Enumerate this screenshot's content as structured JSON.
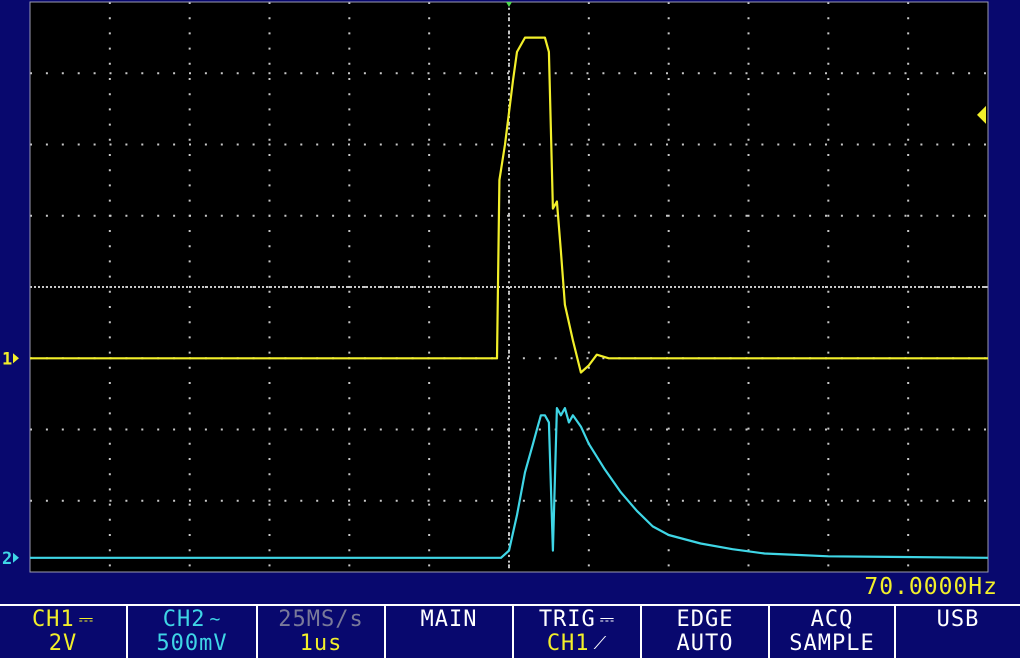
{
  "colors": {
    "ch1": "#f2ef2a",
    "ch2": "#3fd6e6",
    "grid": "#c8c8c8",
    "screen_bg": "#000000",
    "bezel": "#08086e"
  },
  "markers": {
    "ch1": "1",
    "ch2": "2"
  },
  "readout": {
    "frequency": "70.0000Hz"
  },
  "status": {
    "ch1": {
      "label": "CH1",
      "coupling_symbol": "⎓",
      "scale": "2V"
    },
    "ch2": {
      "label": "CH2",
      "coupling_symbol": "∼",
      "scale": "500mV"
    },
    "timebase": {
      "rate": "25MS/s",
      "per_div": "1us"
    },
    "mode": {
      "label": "MAIN"
    },
    "trigger": {
      "label": "TRIG",
      "coupling_symbol": "⎓",
      "source": "CH1",
      "slope_symbol": "⟋"
    },
    "trigger_mode": {
      "type": "EDGE",
      "mode": "AUTO"
    },
    "acquisition": {
      "label": "ACQ",
      "mode": "SAMPLE"
    },
    "storage": {
      "label": "USB"
    }
  },
  "chart_data": {
    "type": "line",
    "x_unit": "us",
    "x_divisions": 12,
    "y_divisions": 8,
    "xlim": [
      -6.0,
      6.0
    ],
    "grid": true,
    "series": [
      {
        "name": "CH1",
        "y_unit": "V",
        "ylim": [
          -6.0,
          10.0
        ],
        "x": [
          -6.0,
          -1.0,
          -0.15,
          -0.12,
          -0.05,
          0.05,
          0.1,
          0.2,
          0.3,
          0.35,
          0.45,
          0.5,
          0.55,
          0.6,
          0.65,
          0.7,
          0.8,
          0.9,
          1.0,
          1.1,
          1.25,
          1.4,
          1.6,
          2.0,
          6.0
        ],
        "values": [
          0.0,
          0.0,
          0.0,
          5.0,
          6.0,
          7.8,
          8.6,
          9.0,
          9.0,
          9.0,
          9.0,
          8.6,
          4.2,
          4.4,
          3.0,
          1.5,
          0.5,
          -0.4,
          -0.2,
          0.1,
          0.0,
          0.0,
          0.0,
          0.0,
          0.0
        ]
      },
      {
        "name": "CH2",
        "y_unit": "V",
        "ylim": [
          -0.1,
          3.9
        ],
        "x": [
          -6.0,
          -0.1,
          0.0,
          0.1,
          0.2,
          0.3,
          0.35,
          0.4,
          0.45,
          0.5,
          0.55,
          0.6,
          0.65,
          0.7,
          0.75,
          0.8,
          0.9,
          1.0,
          1.2,
          1.4,
          1.6,
          1.8,
          2.0,
          2.4,
          2.8,
          3.2,
          3.6,
          4.0,
          6.0
        ],
        "values": [
          0.0,
          0.0,
          0.05,
          0.3,
          0.6,
          0.8,
          0.9,
          1.0,
          1.0,
          0.95,
          0.05,
          1.05,
          1.0,
          1.05,
          0.95,
          1.0,
          0.92,
          0.8,
          0.62,
          0.46,
          0.33,
          0.22,
          0.16,
          0.1,
          0.06,
          0.03,
          0.02,
          0.01,
          0.0
        ]
      }
    ]
  }
}
